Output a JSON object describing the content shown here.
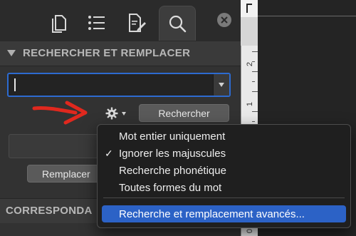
{
  "toolbar": {
    "tabs": [
      {
        "icon": "documents-icon"
      },
      {
        "icon": "list-icon"
      },
      {
        "icon": "edit-document-icon"
      },
      {
        "icon": "search-icon",
        "active": true
      }
    ],
    "close_icon": "close-circle-icon"
  },
  "find_replace": {
    "section_title": "RECHERCHER ET REMPLACER",
    "search_value": "",
    "search_button": "Rechercher",
    "replace_value": "",
    "replace_button": "Remplacer"
  },
  "bottom_section": {
    "title": "CORRESPONDA"
  },
  "ruler": {
    "numbers": [
      "2",
      "1",
      "0"
    ]
  },
  "options_menu": {
    "items": [
      {
        "label": "Mot entier uniquement",
        "checked": false
      },
      {
        "label": "Ignorer les majuscules",
        "checked": true
      },
      {
        "label": "Recherche phonétique",
        "checked": false
      },
      {
        "label": "Toutes formes du mot",
        "checked": false
      }
    ],
    "check_glyph": "✓",
    "advanced_item": "Recherche et remplacement avancés..."
  },
  "colors": {
    "accent": "#2c62c6",
    "focus_border": "#2d6bd0",
    "annotation_arrow": "#e0281e"
  }
}
